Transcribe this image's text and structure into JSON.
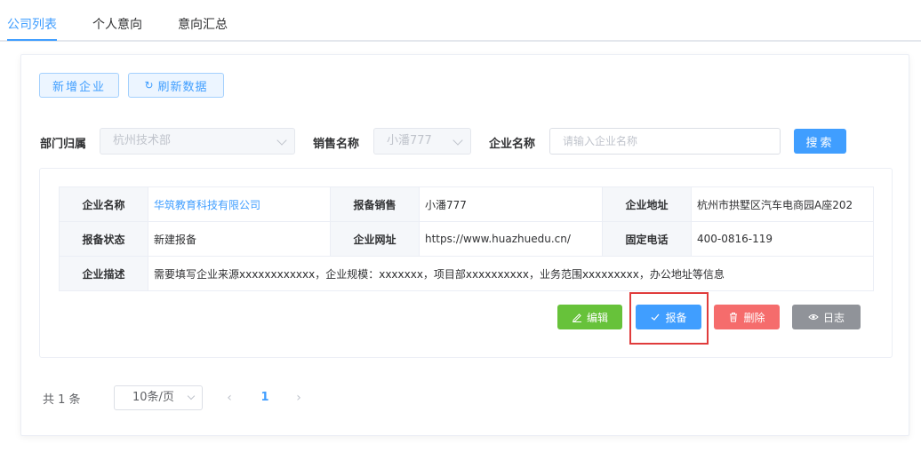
{
  "tabs": [
    {
      "label": "公司列表",
      "active": true
    },
    {
      "label": "个人意向",
      "active": false
    },
    {
      "label": "意向汇总",
      "active": false
    }
  ],
  "toolbar": {
    "add_label": "新增企业",
    "refresh_label": "刷新数据"
  },
  "filters": {
    "department_label": "部门归属",
    "department_value": "杭州技术部",
    "sales_label": "销售名称",
    "sales_value": "小潘777",
    "company_label": "企业名称",
    "company_placeholder": "请输入企业名称",
    "search_label": "搜索"
  },
  "company": {
    "name_label": "企业名称",
    "name_value": "华筑教育科技有限公司",
    "sales_label": "报备销售",
    "sales_value": "小潘777",
    "address_label": "企业地址",
    "address_value": "杭州市拱墅区汽车电商园A座202",
    "status_label": "报备状态",
    "status_value": "新建报备",
    "website_label": "企业网址",
    "website_value": "https://www.huazhuedu.cn/",
    "phone_label": "固定电话",
    "phone_value": "400-0816-119",
    "desc_label": "企业描述",
    "desc_value": "需要填写企业来源xxxxxxxxxxxx，企业规模：xxxxxxx，项目部xxxxxxxxxx，业务范围xxxxxxxxx，办公地址等信息"
  },
  "actions": {
    "edit_label": "编辑",
    "report_label": "报备",
    "delete_label": "删除",
    "log_label": "日志"
  },
  "colors": {
    "primary": "#409eff",
    "success": "#67c23a",
    "danger": "#f56c6c",
    "info": "#909399",
    "highlight": "#e03c3c"
  },
  "pagination": {
    "total_text": "共 1 条",
    "page_size": "10条/页",
    "current_page": "1"
  }
}
